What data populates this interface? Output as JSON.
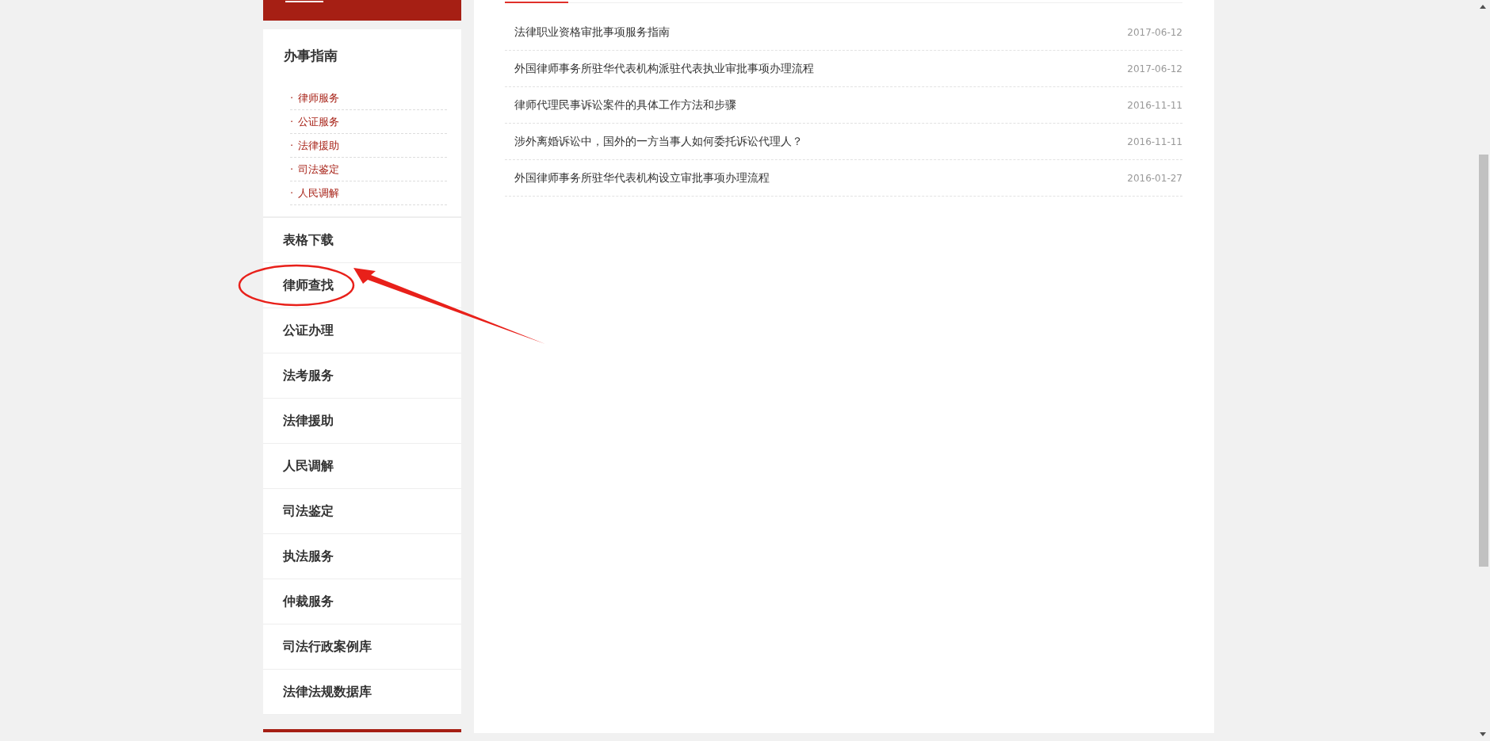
{
  "sidebar": {
    "guide": {
      "title": "办事指南",
      "items": [
        {
          "label": "律师服务",
          "bullet": "·"
        },
        {
          "label": "公证服务",
          "bullet": "·"
        },
        {
          "label": "法律援助",
          "bullet": "·"
        },
        {
          "label": "司法鉴定",
          "bullet": "·"
        },
        {
          "label": "人民调解",
          "bullet": "·"
        }
      ]
    },
    "menu": [
      {
        "label": "表格下载",
        "circled": false
      },
      {
        "label": "律师查找",
        "circled": true
      },
      {
        "label": "公证办理",
        "circled": false
      },
      {
        "label": "法考服务",
        "circled": false
      },
      {
        "label": "法律援助",
        "circled": false
      },
      {
        "label": "人民调解",
        "circled": false
      },
      {
        "label": "司法鉴定",
        "circled": false
      },
      {
        "label": "执法服务",
        "circled": false
      },
      {
        "label": "仲裁服务",
        "circled": false
      },
      {
        "label": "司法行政案例库",
        "circled": false
      },
      {
        "label": "法律法规数据库",
        "circled": false
      }
    ]
  },
  "articles": [
    {
      "title": "法律职业资格审批事项服务指南",
      "date": "2017-06-12"
    },
    {
      "title": "外国律师事务所驻华代表机构派驻代表执业审批事项办理流程",
      "date": "2017-06-12"
    },
    {
      "title": "律师代理民事诉讼案件的具体工作方法和步骤",
      "date": "2016-11-11"
    },
    {
      "title": "涉外离婚诉讼中，国外的一方当事人如何委托诉讼代理人？",
      "date": "2016-11-11"
    },
    {
      "title": "外国律师事务所驻华代表机构设立审批事项办理流程",
      "date": "2016-01-27"
    }
  ]
}
